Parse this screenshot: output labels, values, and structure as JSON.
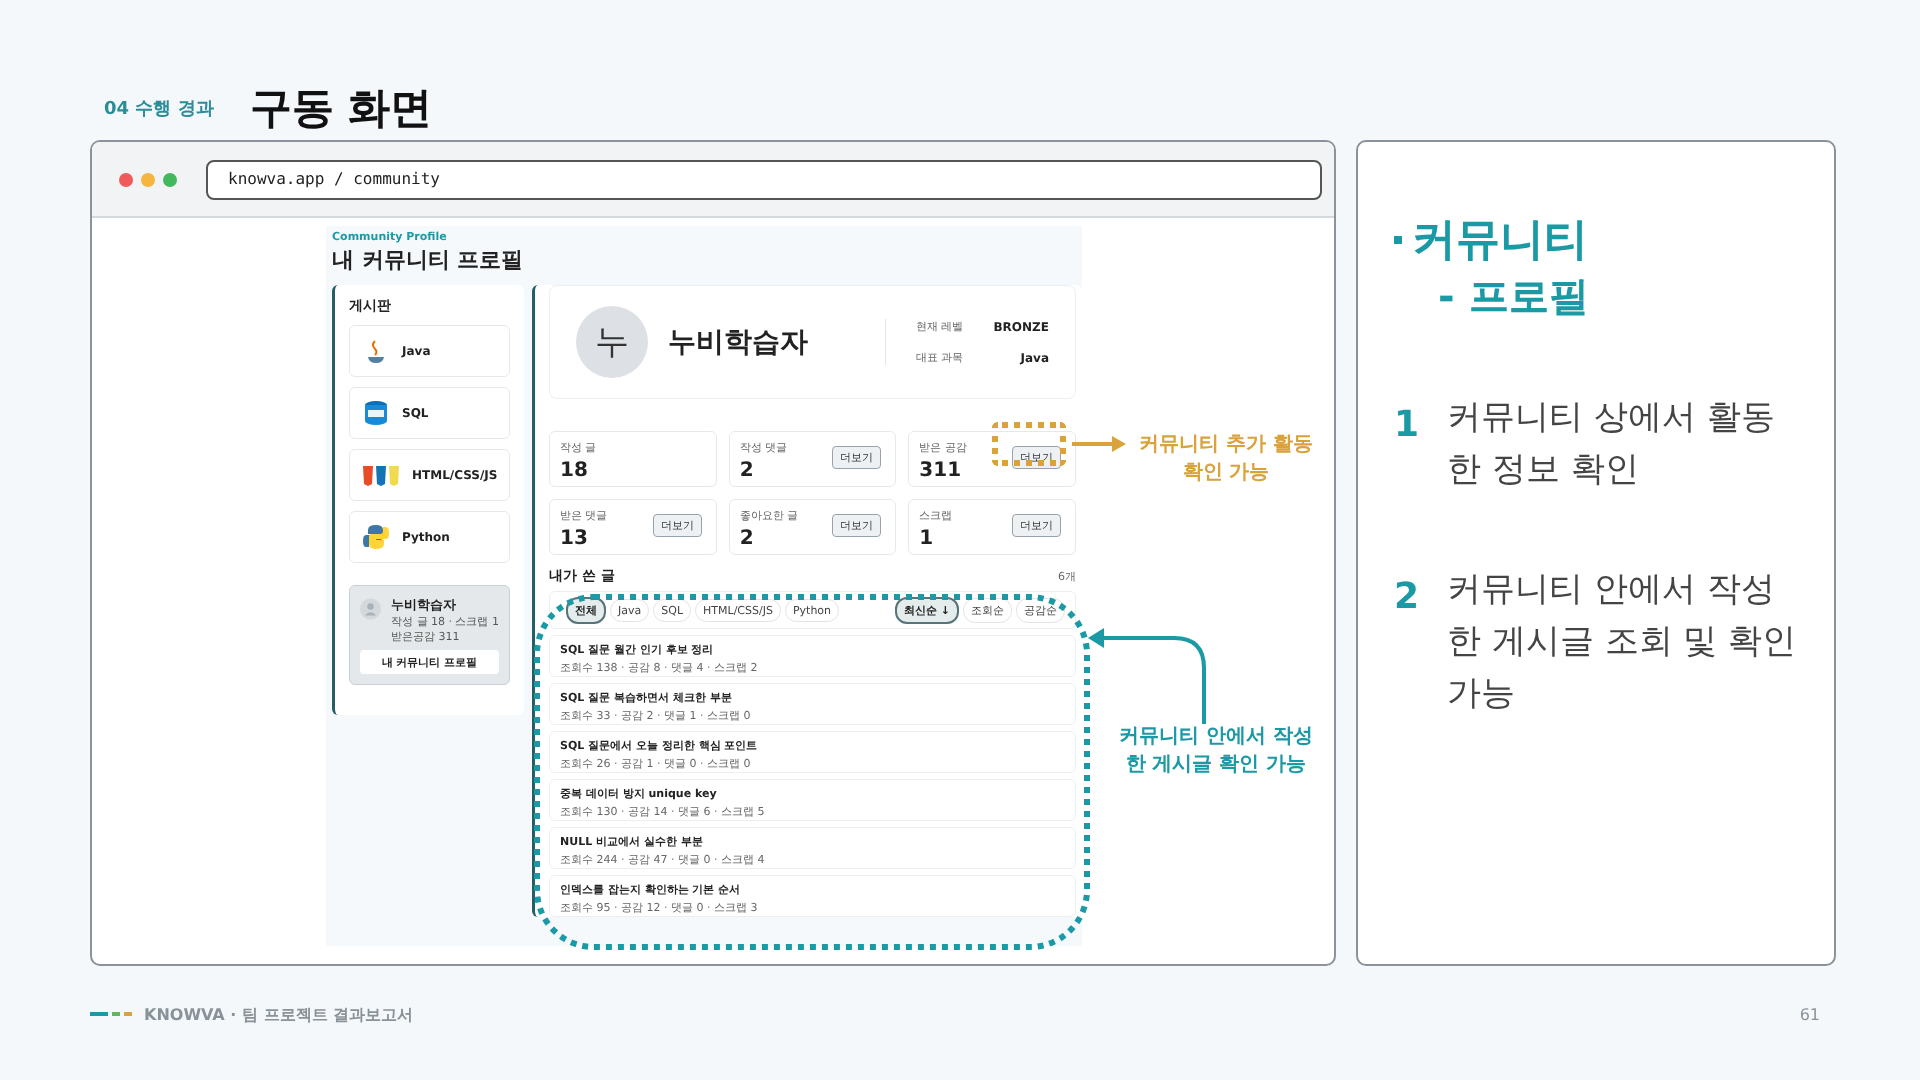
{
  "header": {
    "section": "04 수행 경과",
    "title": "구동 화면"
  },
  "browser": {
    "url": "knowva.app / community"
  },
  "app": {
    "eyebrow": "Community Profile",
    "title": "내 커뮤니티 프로필",
    "sidebar": {
      "heading": "게시판",
      "boards": [
        {
          "label": "Java",
          "kind": "java"
        },
        {
          "label": "SQL",
          "kind": "sql"
        },
        {
          "label": "HTML/CSS/JS",
          "kind": "web"
        },
        {
          "label": "Python",
          "kind": "python"
        }
      ],
      "user": {
        "name": "누비학습자",
        "line_1": "작성 글 18 · 스크랩 1",
        "line_2": "받은공감 311",
        "button": "내 커뮤니티 프로필"
      }
    },
    "profile": {
      "avatar": "누",
      "name": "누비학습자",
      "fields": [
        {
          "label": "현재 레벨",
          "value": "BRONZE"
        },
        {
          "label": "대표 과목",
          "value": "Java"
        }
      ]
    },
    "stats": [
      {
        "label": "작성 글",
        "value": "18"
      },
      {
        "label": "작성 댓글",
        "value": "2",
        "button": "더보기"
      },
      {
        "label": "받은 공감",
        "value": "311",
        "button": "더보기"
      },
      {
        "label": "받은 댓글",
        "value": "13",
        "button": "더보기"
      },
      {
        "label": "좋아요한 글",
        "value": "2",
        "button": "더보기"
      },
      {
        "label": "스크랩",
        "value": "1",
        "button": "더보기"
      }
    ],
    "posts": {
      "heading": "내가 쓴 글",
      "count": "6개",
      "filters": [
        {
          "label": "전체",
          "selected": true
        },
        {
          "label": "Java",
          "selected": false
        },
        {
          "label": "SQL",
          "selected": false
        },
        {
          "label": "HTML/CSS/JS",
          "selected": false
        },
        {
          "label": "Python",
          "selected": false
        }
      ],
      "sorts": [
        {
          "label": "최신순 ↓",
          "selected": true
        },
        {
          "label": "조회순",
          "selected": false
        },
        {
          "label": "공감순",
          "selected": false
        }
      ],
      "items": [
        {
          "title": "SQL 질문 월간 인기 후보 정리",
          "meta": "조회수 138 · 공감 8 · 댓글 4 · 스크랩 2"
        },
        {
          "title": "SQL 질문 복습하면서 체크한 부분",
          "meta": "조회수 33 · 공감 2 · 댓글 1 · 스크랩 0"
        },
        {
          "title": "SQL 질문에서 오늘 정리한 핵심 포인트",
          "meta": "조회수 26 · 공감 1 · 댓글 0 · 스크랩 0"
        },
        {
          "title": "중복 데이터 방지 unique key",
          "meta": "조회수 130 · 공감 14 · 댓글 6 · 스크랩 5"
        },
        {
          "title": "NULL 비교에서 실수한 부분",
          "meta": "조회수 244 · 공감 47 · 댓글 0 · 스크랩 4"
        },
        {
          "title": "인덱스를 잡는지 확인하는 기본 순서",
          "meta": "조회수 95 · 공감 12 · 댓글 0 · 스크랩 3"
        }
      ]
    }
  },
  "annotations": [
    {
      "kind": "gold",
      "text": "커뮤니티 추가 활동 확인 가능"
    },
    {
      "kind": "teal",
      "text": "커뮤니티 안에서 작성한 게시글 확인 가능"
    }
  ],
  "notes": {
    "heading": "커뮤니티",
    "subheading": "- 프로필",
    "points": [
      {
        "number": "1",
        "text": "커뮤니티 상에서 활동한 정보 확인"
      },
      {
        "number": "2",
        "text": "커뮤니티 안에서 작성한 게시글 조회 및 확인 가능"
      }
    ]
  },
  "footer": {
    "brand": "KNOWVA · 팀 프로젝트 결과보고서",
    "page": "61"
  }
}
